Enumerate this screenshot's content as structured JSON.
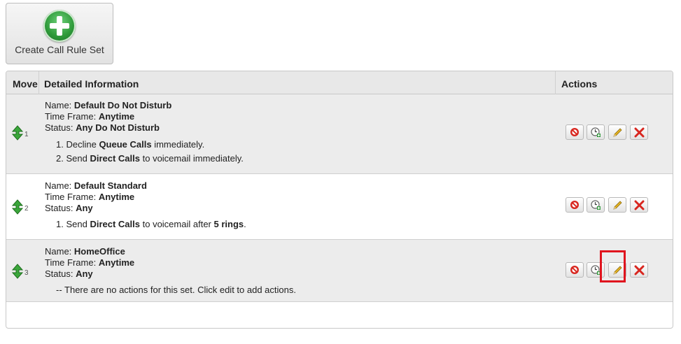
{
  "create_button": {
    "label": "Create Call Rule Set",
    "icon": "plus-circle-icon"
  },
  "table": {
    "headers": {
      "move": "Move",
      "details": "Detailed Information",
      "actions": "Actions"
    },
    "labels": {
      "name": "Name:",
      "time_frame": "Time Frame:",
      "status": "Status:"
    },
    "rows": [
      {
        "order": "1",
        "name": "Default Do Not Disturb",
        "time_frame": "Anytime",
        "status": "Any Do Not Disturb",
        "steps": [
          {
            "n": "1.",
            "pre": "Decline ",
            "bold": "Queue Calls",
            "post": " immediately."
          },
          {
            "n": "2.",
            "pre": "Send ",
            "bold": "Direct Calls",
            "post": " to voicemail immediately."
          }
        ]
      },
      {
        "order": "2",
        "name": "Default Standard",
        "time_frame": "Anytime",
        "status": "Any",
        "steps": [
          {
            "n": "1.",
            "pre": "Send ",
            "bold": "Direct Calls",
            "post": " to voicemail after ",
            "bold2": "5 rings",
            "post2": "."
          }
        ]
      },
      {
        "order": "3",
        "name": "HomeOffice",
        "time_frame": "Anytime",
        "status": "Any",
        "note": "-- There are no actions for this set. Click edit to add actions."
      }
    ]
  },
  "action_icons": [
    "disable-icon",
    "schedule-icon",
    "edit-pencil-icon",
    "delete-icon"
  ],
  "colors": {
    "highlight": "#e0141e",
    "plus_green": "#2f9a3a",
    "move_green": "#3aa63a",
    "delete_red": "#d8261f",
    "pencil_yellow": "#e6b422"
  }
}
